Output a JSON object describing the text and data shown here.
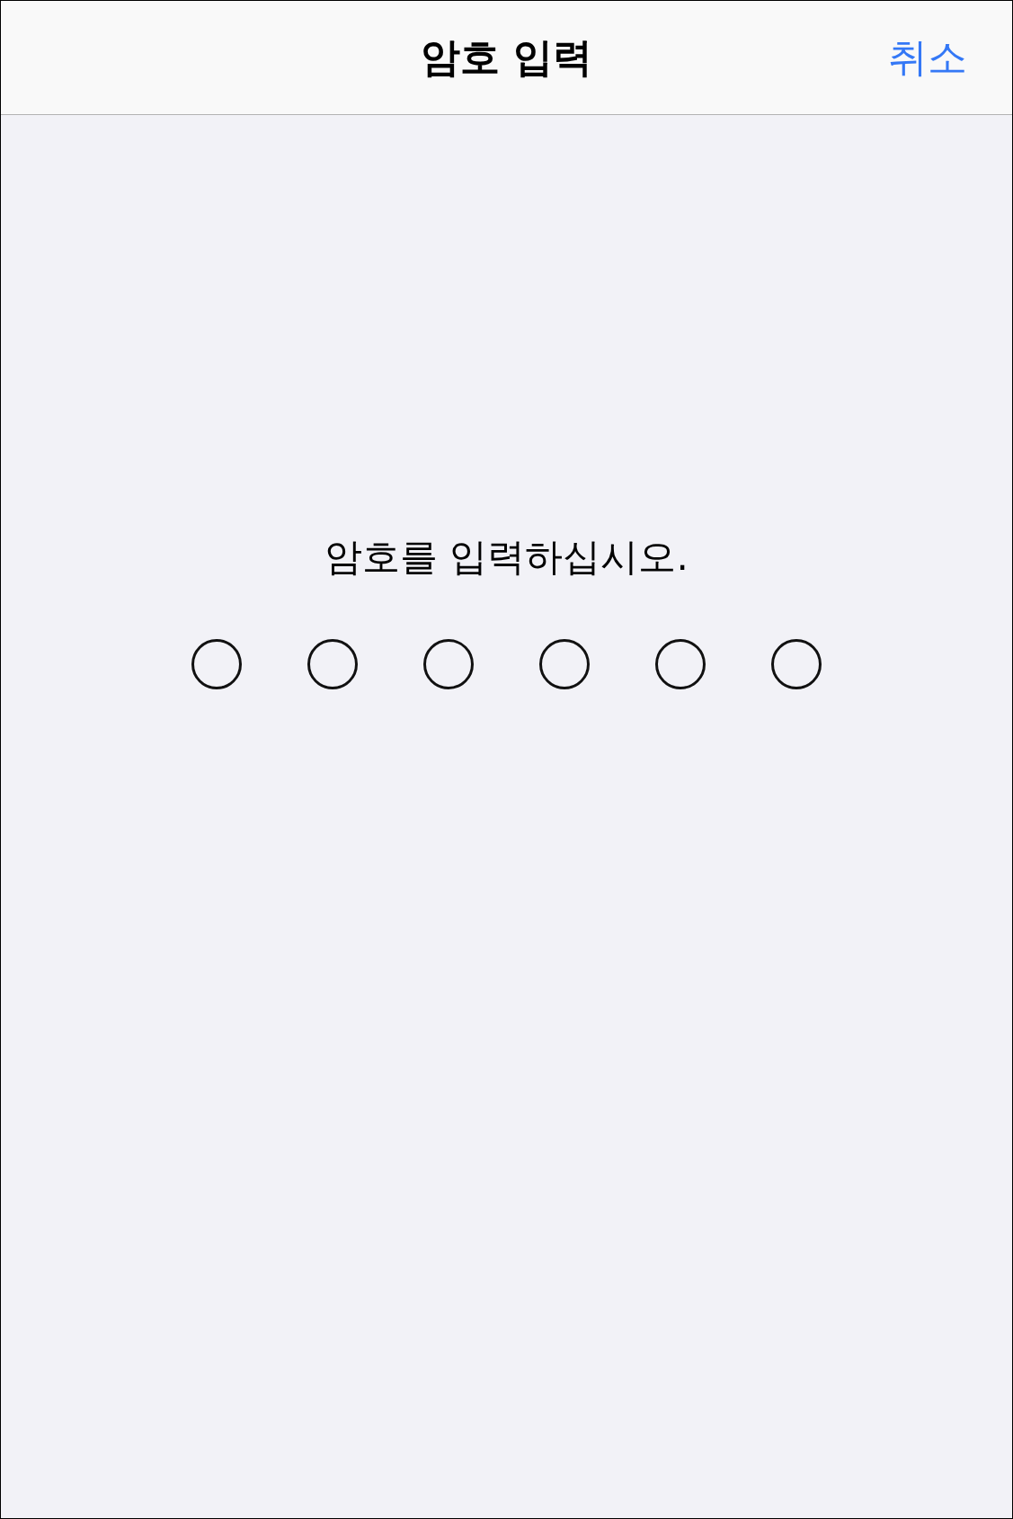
{
  "nav_bar": {
    "title": "암호 입력",
    "cancel": "취소"
  },
  "prompt": "암호를 입력하십시오.",
  "passcode_dots": [
    {
      "filled": false
    },
    {
      "filled": false
    },
    {
      "filled": false
    },
    {
      "filled": false
    },
    {
      "filled": false
    },
    {
      "filled": false
    }
  ]
}
